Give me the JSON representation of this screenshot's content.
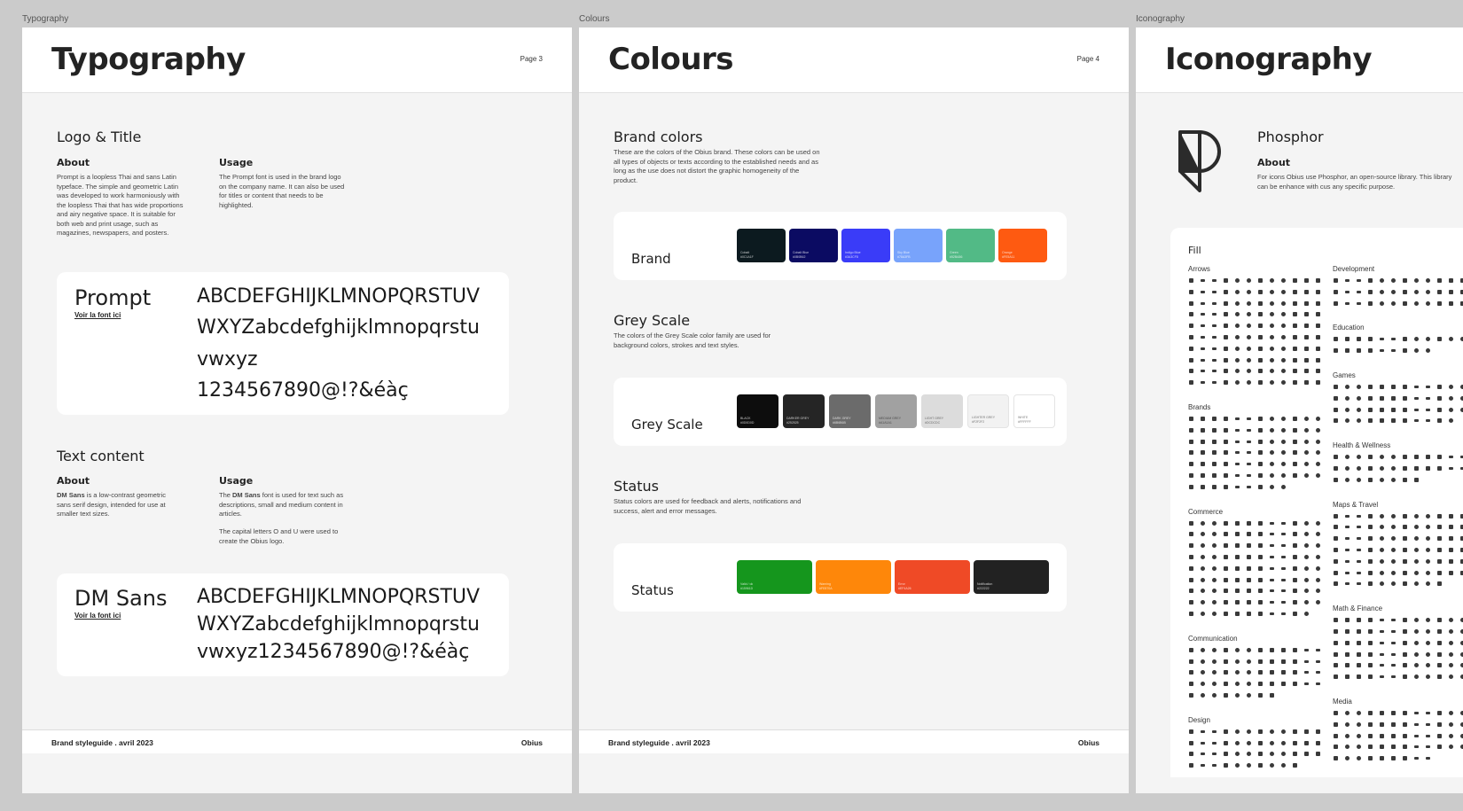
{
  "frames": {
    "typography": {
      "label": "Typography",
      "title": "Typography",
      "page": "Page 3",
      "logo_title": {
        "heading": "Logo & Title",
        "about_heading": "About",
        "about_text": "Prompt is a loopless Thai and sans Latin typeface. The simple and geometric Latin was developed to work harmoniously with the loopless Thai that has wide proportions and airy negative space. It is suitable for both web and print usage, such as magazines, newspapers, and posters.",
        "usage_heading": "Usage",
        "usage_text": "The Prompt font is used in the brand logo on the company name. It can also be used for titles or content that needs to be highlighted."
      },
      "prompt_card": {
        "name": "Prompt",
        "link": "Voir la font ici",
        "lines": [
          "ABCDEFGHIJKLMNOPQRSTUV",
          "WXYZabcdefghijklmnopqrstu",
          "vwxyz",
          "1234567890@!?&éàç"
        ]
      },
      "text_content": {
        "heading": "Text content",
        "about_heading": "About",
        "about_bold": "DM Sans",
        "about_text": " is a low-contrast geometric sans serif design, intended for use at smaller text sizes.",
        "usage_heading": "Usage",
        "usage_pre": "The ",
        "usage_bold": "DM Sans",
        "usage_text": " font is used for text such as descriptions, small and medium content in articles.",
        "usage_text2": "The capital letters O and U were used to create the Obius logo."
      },
      "dmsans_card": {
        "name": "DM Sans",
        "link": "Voir la font ici",
        "lines": [
          "ABCDEFGHIJKLMNOPQRSTUV",
          "WXYZabcdefghijklmnopqrstu",
          "vwxyz1234567890@!?&éàç"
        ]
      },
      "footer_left": "Brand styleguide . avril 2023",
      "footer_right": "Obius"
    },
    "colours": {
      "label": "Colours",
      "title": "Colours",
      "page": "Page 4",
      "brand": {
        "heading": "Brand colors",
        "text": "These are the colors of the Obius brand. These colors can be used on all types of objects or texts according to the established needs and as long as the use does not distort the graphic homogeneity of the product.",
        "card_label": "Brand",
        "swatches": [
          {
            "color": "#0c1a1f",
            "name": "Cobalt",
            "code": "#0C1A1F"
          },
          {
            "color": "#0b0b62",
            "name": "Cobalt Blue",
            "code": "#0B0B62"
          },
          {
            "color": "#3a3cf8",
            "name": "Indigo Blue",
            "code": "#3A3CF8"
          },
          {
            "color": "#78a3fb",
            "name": "Sky Blue",
            "code": "#78A3FB"
          },
          {
            "color": "#52ba86",
            "name": "Green",
            "code": "#52BA86"
          },
          {
            "color": "#fe5a11",
            "name": "Orange",
            "code": "#FE5A11"
          }
        ]
      },
      "grey": {
        "heading": "Grey Scale",
        "text": "The colors of the Grey Scale color family are used for background colors, strokes and text styles.",
        "card_label": "Grey Scale",
        "swatches": [
          {
            "color": "#0d0d0d",
            "name": "BLACK",
            "code": "#0D0D0D",
            "dark": false
          },
          {
            "color": "#252525",
            "name": "DARKER GREY",
            "code": "#252525",
            "dark": false
          },
          {
            "color": "#6b6b6b",
            "name": "DARK GREY",
            "code": "#6B6B6B",
            "dark": false
          },
          {
            "color": "#a1a1a1",
            "name": "MEDIUM GREY",
            "code": "#A1A1A1",
            "dark": true
          },
          {
            "color": "#dcdcdc",
            "name": "LIGHT GREY",
            "code": "#DCDCDC",
            "dark": true
          },
          {
            "color": "#f2f2f2",
            "name": "LIGHTER GREY",
            "code": "#F2F2F2",
            "dark": true
          },
          {
            "color": "#ffffff",
            "name": "WHITE",
            "code": "#FFFFFF",
            "dark": true
          }
        ]
      },
      "status": {
        "heading": "Status",
        "text": "Status colors are used for feedback and alerts, notifications and success, alert and error messages.",
        "card_label": "Status",
        "swatches": [
          {
            "color": "#15961d",
            "name": "Valid / ok",
            "code": "#15961D"
          },
          {
            "color": "#fe870a",
            "name": "Warning",
            "code": "#FE870A"
          },
          {
            "color": "#ef4a26",
            "name": "Error",
            "code": "#EF4A26"
          },
          {
            "color": "#222222",
            "name": "Notification",
            "code": "#222222"
          }
        ]
      },
      "footer_left": "Brand styleguide . avril 2023",
      "footer_right": "Obius"
    },
    "iconography": {
      "label": "Iconography",
      "title": "Iconography",
      "library_heading": "Phosphor",
      "about_heading": "About",
      "about_text": "For icons Obius use Phosphor, an open-source library. This library can be enhance with cus any specific purpose.",
      "fill_heading": "Fill",
      "left_categories": [
        {
          "name": "Arrows",
          "rows": 10
        },
        {
          "name": "Brands",
          "rows": 7
        },
        {
          "name": "Commerce",
          "rows": 9
        },
        {
          "name": "Communication",
          "rows": 5
        },
        {
          "name": "Design",
          "rows": 4
        }
      ],
      "right_categories": [
        {
          "name": "Development",
          "rows": 3
        },
        {
          "name": "Education",
          "rows": 2
        },
        {
          "name": "Games",
          "rows": 4
        },
        {
          "name": "Health & Wellness",
          "rows": 3
        },
        {
          "name": "Maps & Travel",
          "rows": 7
        },
        {
          "name": "Math & Finance",
          "rows": 6
        },
        {
          "name": "Media",
          "rows": 5
        }
      ]
    }
  }
}
